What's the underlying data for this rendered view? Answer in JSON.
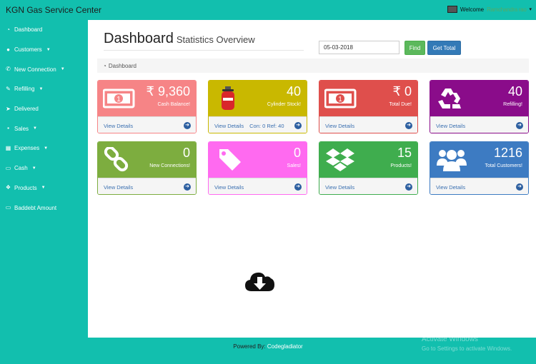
{
  "app": {
    "title": "KGN Gas Service Center"
  },
  "user": {
    "greeting": "Welcome",
    "name": "Ramchandra rao"
  },
  "sidebar": {
    "items": [
      {
        "label": "Dashboard",
        "icon": "dashboard-icon",
        "has_submenu": false
      },
      {
        "label": "Customers",
        "icon": "users-icon",
        "has_submenu": true
      },
      {
        "label": "New Connection",
        "icon": "phone-icon",
        "has_submenu": true
      },
      {
        "label": "Refilling",
        "icon": "wrench-icon",
        "has_submenu": true
      },
      {
        "label": "Delivered",
        "icon": "send-icon",
        "has_submenu": false
      },
      {
        "label": "Sales",
        "icon": "cart-icon",
        "has_submenu": true
      },
      {
        "label": "Expenses",
        "icon": "table-icon",
        "has_submenu": true
      },
      {
        "label": "Cash",
        "icon": "money-icon",
        "has_submenu": true
      },
      {
        "label": "Products",
        "icon": "dropbox-icon",
        "has_submenu": true
      },
      {
        "label": "Baddebt Amount",
        "icon": "card-icon",
        "has_submenu": false
      }
    ]
  },
  "header": {
    "title": "Dashboard",
    "subtitle": "Statistics Overview"
  },
  "filter": {
    "date_value": "05-03-2018",
    "find_label": "Find",
    "total_label": "Get Total"
  },
  "breadcrumb": {
    "label": "Dashboard"
  },
  "cards": [
    {
      "value": "₹ 9,360",
      "label": "Cash Balance!",
      "footer": "View Details",
      "extra": "",
      "icon": "money-icon",
      "color": "#f68486"
    },
    {
      "value": "40",
      "label": "Cylinder Stock!",
      "footer": "View Details",
      "extra": "Con: 0  Ref: 40",
      "icon": "gas-cylinder-icon",
      "color": "#c9b800"
    },
    {
      "value": "₹ 0",
      "label": "Total Due!",
      "footer": "View Details",
      "extra": "",
      "icon": "money-icon",
      "color": "#df4f4c"
    },
    {
      "value": "40",
      "label": "Refilling!",
      "footer": "View Details",
      "extra": "",
      "icon": "recycle-icon",
      "color": "#8a0c8a"
    },
    {
      "value": "0",
      "label": "New Connections!",
      "footer": "View Details",
      "extra": "",
      "icon": "chain-link-icon",
      "color": "#7dad3f"
    },
    {
      "value": "0",
      "label": "Sales!",
      "footer": "View Details",
      "extra": "",
      "icon": "tag-icon",
      "color": "#ff6af0"
    },
    {
      "value": "15",
      "label": "Products!",
      "footer": "View Details",
      "extra": "",
      "icon": "dropbox-icon",
      "color": "#3fad4e"
    },
    {
      "value": "1216",
      "label": "Total Customers!",
      "footer": "View Details",
      "extra": "",
      "icon": "users-icon",
      "color": "#3d7bc2"
    }
  ],
  "footer": {
    "prefix": "Powered By:",
    "link": "Codegladiator"
  },
  "watermark": {
    "line1": "Activate Windows",
    "line2": "Go to Settings to activate Windows."
  }
}
